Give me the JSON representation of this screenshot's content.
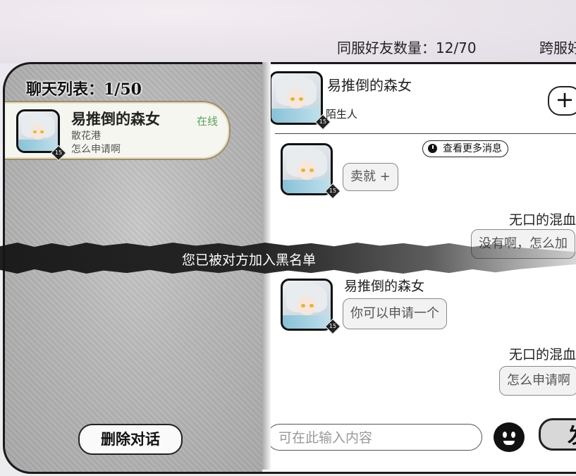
{
  "top": {
    "friend_count": "同服好友数量：12/70",
    "cross_server": "跨服好"
  },
  "chat_list": {
    "title": "聊天列表：1/50",
    "items": [
      {
        "name": "易推倒的森女",
        "status": "在线",
        "location": "散花港",
        "last_message": "怎么申请啊",
        "level": "15"
      }
    ],
    "delete_label": "删除对话"
  },
  "conversation": {
    "contact_name": "易推倒的森女",
    "relation": "陌生人",
    "level": "15",
    "add_label": "+",
    "more_label": "查看更多消息",
    "messages": [
      {
        "side": "left",
        "text": "卖就 +",
        "level": "15"
      },
      {
        "side": "right",
        "sender": "无口的混血",
        "text": "没有啊，怎么加"
      },
      {
        "side": "left",
        "sender": "易推倒的森女",
        "text": "你可以申请一个",
        "level": "15"
      },
      {
        "side": "right",
        "sender": "无口的混血",
        "text": "怎么申请啊"
      }
    ],
    "input_placeholder": "可在此输入内容",
    "send_label": "发"
  },
  "banner": {
    "text": "您已被对方加入黑名单"
  },
  "icons": {
    "emoji": "smiley-icon",
    "clock": "clock-icon",
    "add": "plus-icon"
  }
}
